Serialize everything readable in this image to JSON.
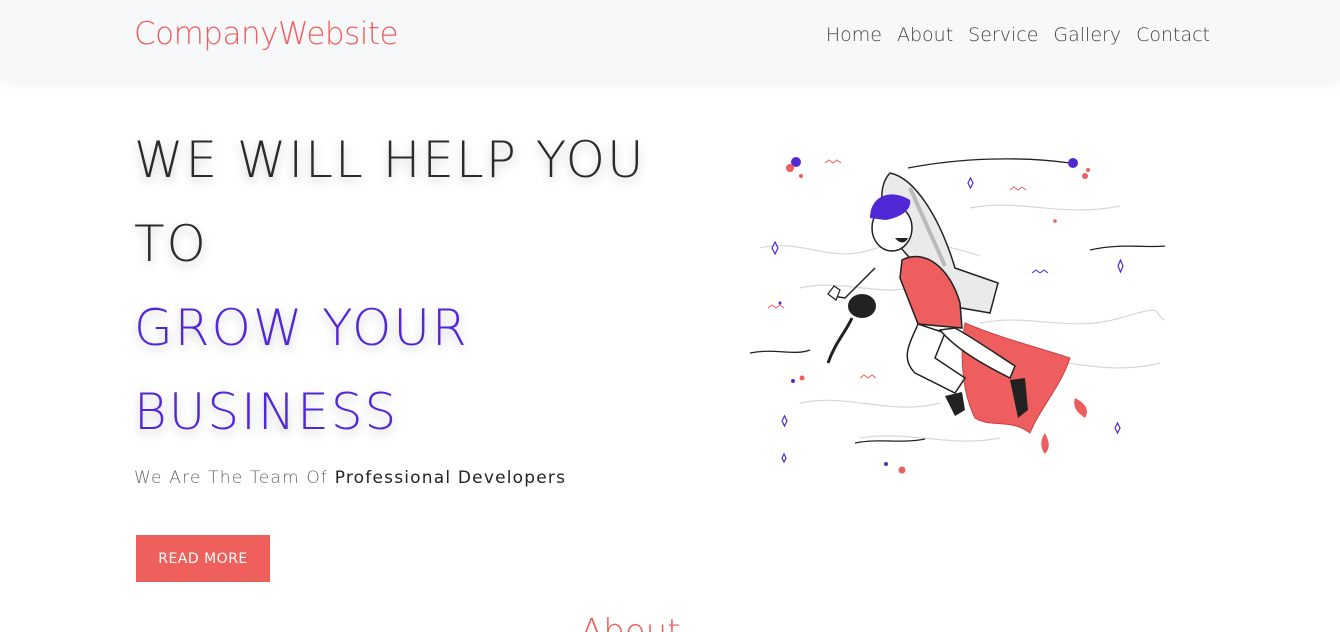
{
  "brand": "CompanyWebsite",
  "nav": {
    "items": [
      {
        "label": "Home"
      },
      {
        "label": "About"
      },
      {
        "label": "Service"
      },
      {
        "label": "Gallery"
      },
      {
        "label": "Contact"
      }
    ]
  },
  "hero": {
    "line1": "WE WILL HELP YOU",
    "line2": "TO",
    "line3": "GROW YOUR",
    "line4": "BUSINESS",
    "tagline_plain": "We Are The Team Of ",
    "tagline_strong": "Professional Developers",
    "cta_label": "READ MORE",
    "illustration_icon": "rocket-boy-illustration"
  },
  "next_section": {
    "title_peek": "About"
  },
  "colors": {
    "brand": "#ee5e5e",
    "accent_purple": "#5228d6",
    "button": "#ef5f5b",
    "navbar_bg": "#f7f8f9"
  }
}
